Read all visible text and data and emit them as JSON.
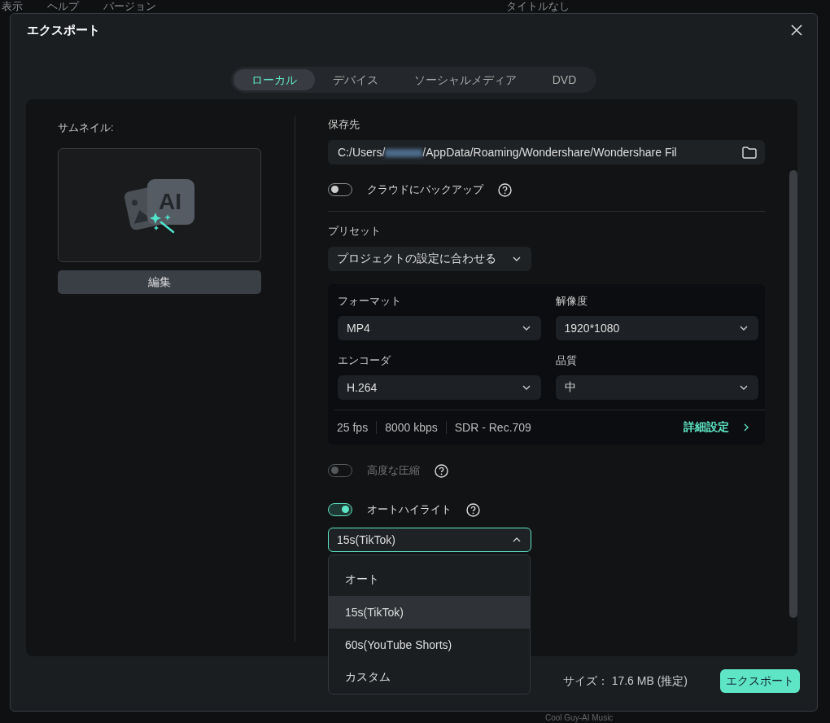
{
  "background_app": {
    "menu": [
      "表示",
      "ヘルプ",
      "バージョン"
    ],
    "title": "タイトルなし",
    "track_label": "Cool Guy-AI Music"
  },
  "dialog": {
    "title": "エクスポート"
  },
  "tabs": [
    {
      "label": "ローカル",
      "selected": true
    },
    {
      "label": "デバイス",
      "selected": false
    },
    {
      "label": "ソーシャルメディア",
      "selected": false
    },
    {
      "label": "DVD",
      "selected": false
    }
  ],
  "thumbnail": {
    "label": "サムネイル:",
    "icon_text": "AI",
    "edit_button": "編集"
  },
  "save_to": {
    "label": "保存先",
    "path_prefix": "C:/Users/",
    "path_suffix": "/AppData/Roaming/Wondershare/Wondershare Fil"
  },
  "cloud_backup": {
    "label": "クラウドにバックアップ",
    "on": false,
    "disabled": false
  },
  "preset": {
    "label": "プリセット",
    "value": "プロジェクトの設定に合わせる"
  },
  "settings": [
    {
      "label": "フォーマット",
      "value": "MP4"
    },
    {
      "label": "解像度",
      "value": "1920*1080"
    },
    {
      "label": "エンコーダ",
      "value": "H.264"
    },
    {
      "label": "品質",
      "value": "中"
    }
  ],
  "summary": [
    "25 fps",
    "8000 kbps",
    "SDR - Rec.709"
  ],
  "advanced_link": "詳細設定",
  "toggles": [
    {
      "label": "高度な圧縮",
      "on": false,
      "disabled": true
    },
    {
      "label": "オートハイライト",
      "on": true,
      "disabled": false
    }
  ],
  "highlight_select": {
    "value": "15s(TikTok)",
    "expanded": true,
    "options": [
      {
        "label": "オート",
        "selected": false
      },
      {
        "label": "15s(TikTok)",
        "selected": true
      },
      {
        "label": "60s(YouTube Shorts)",
        "selected": false
      },
      {
        "label": "カスタム",
        "selected": false
      }
    ]
  },
  "footer": {
    "size_label": "サイズ：",
    "size_value": "17.6 MB (推定)",
    "export_button": "エクスポート"
  }
}
